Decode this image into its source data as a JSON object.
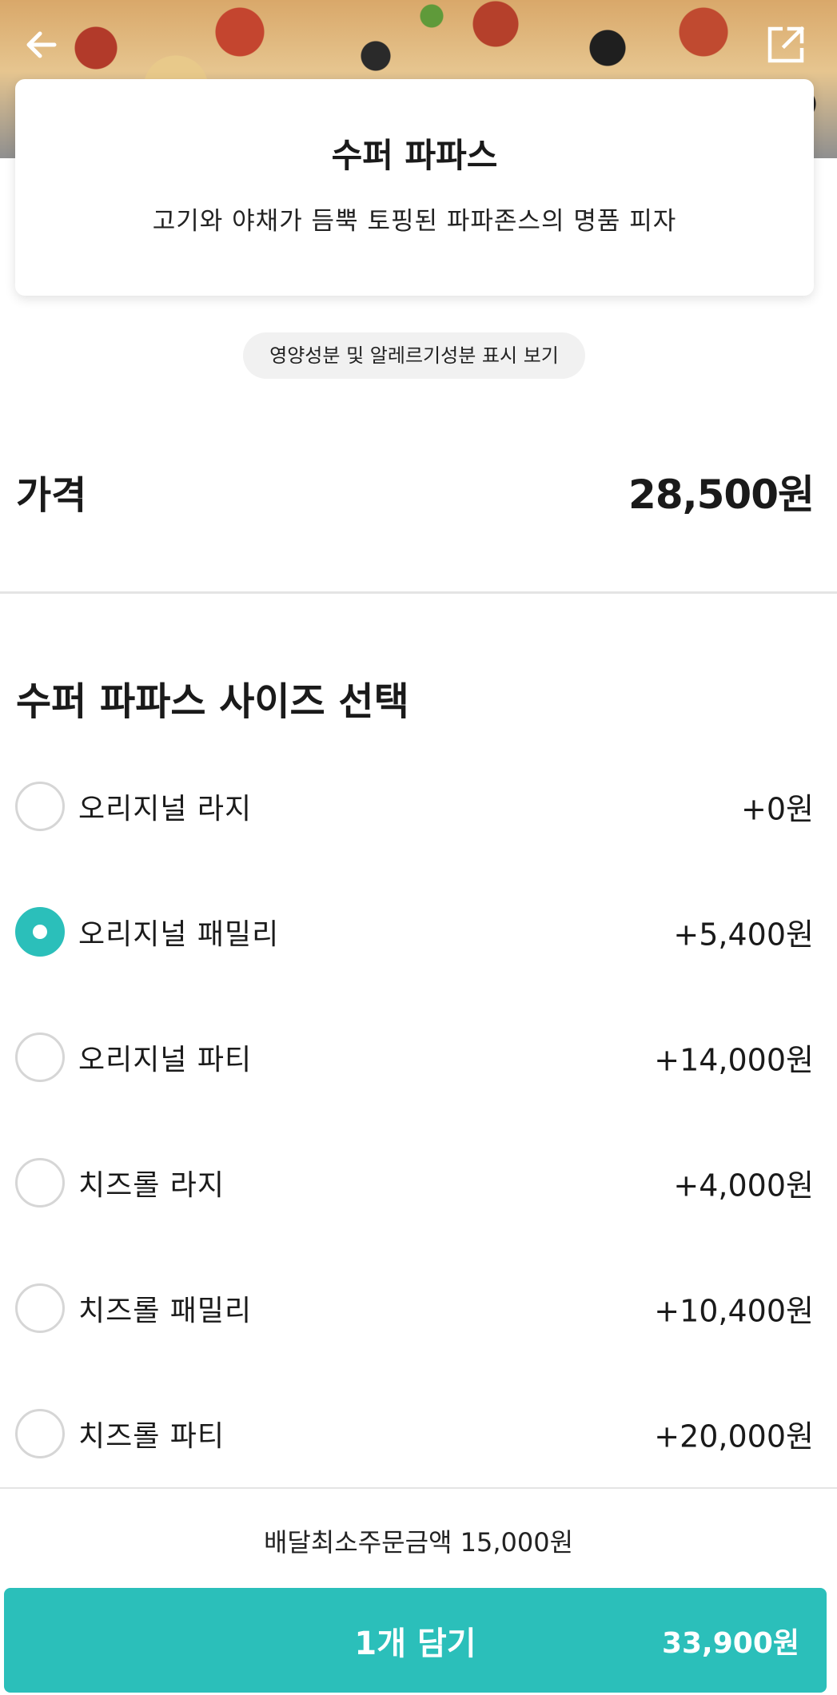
{
  "product": {
    "name": "수퍼 파파스",
    "description": "고기와 야채가 듬뿍 토핑된 파파존스의 명품 피자"
  },
  "nutrition_link": "영양성분 및 알레르기성분 표시 보기",
  "price": {
    "label": "가격",
    "value": "28,500원"
  },
  "size_section": {
    "title": "수퍼 파파스 사이즈 선택",
    "options": [
      {
        "label": "오리지널 라지",
        "price": "+0원",
        "selected": false
      },
      {
        "label": "오리지널 패밀리",
        "price": "+5,400원",
        "selected": true
      },
      {
        "label": "오리지널 파티",
        "price": "+14,000원",
        "selected": false
      },
      {
        "label": "치즈롤 라지",
        "price": "+4,000원",
        "selected": false
      },
      {
        "label": "치즈롤 패밀리",
        "price": "+10,400원",
        "selected": false
      },
      {
        "label": "치즈롤 파티",
        "price": "+20,000원",
        "selected": false
      }
    ]
  },
  "min_order": "배달최소주문금액 15,000원",
  "cart_button": {
    "label": "1개 담기",
    "total": "33,900원"
  },
  "icons": {
    "back": "arrow-left-icon",
    "share": "share-icon"
  },
  "colors": {
    "accent": "#2bbfba",
    "radio_border": "#d6d6d6",
    "chip_bg": "#f1f1f1"
  }
}
